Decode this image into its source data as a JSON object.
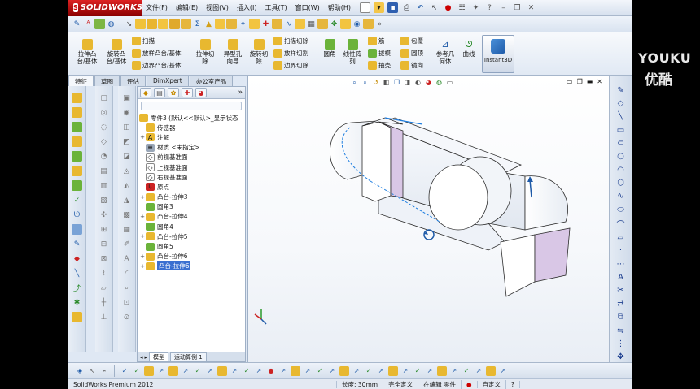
{
  "app": {
    "logo_text": "SOLIDWORKS",
    "menus": [
      "文件(F)",
      "编辑(E)",
      "视图(V)",
      "插入(I)",
      "工具(T)",
      "窗口(W)",
      "帮助(H)"
    ]
  },
  "command_manager": {
    "extrude_boss": "拉伸凸\n台/基体",
    "revolve_boss": "旋转凸\n台/基体",
    "sweep": "扫描",
    "loft_boss": "放样凸台/基体",
    "boundary_boss": "边界凸台/基体",
    "extrude_cut": "拉伸切\n除",
    "hole_wizard": "异型孔\n向导",
    "revolve_cut": "旋转切\n除",
    "swept_cut": "扫描切除",
    "lofted_cut": "放样切割",
    "boundary_cut": "边界切除",
    "fillet": "圆角",
    "linear_pattern": "线性阵\n列",
    "rib": "筋",
    "draft": "拔模",
    "shell": "抽壳",
    "wrap": "包覆",
    "dome": "圆顶",
    "mirror": "镜向",
    "reference_geometry": "参考几\n何体",
    "curves": "曲线",
    "instant3d": "Instant3D"
  },
  "cmd_tabs": [
    "特征",
    "草图",
    "评估",
    "DimXpert",
    "办公室产品"
  ],
  "feature_tree": {
    "root": "零件3  (默认<<默认>_显示状态",
    "items": [
      {
        "label": "传感器",
        "icon": "sensor-icon",
        "expand": ""
      },
      {
        "label": "注解",
        "icon": "annotation-icon",
        "expand": "+"
      },
      {
        "label": "材质 <未指定>",
        "icon": "material-icon",
        "expand": ""
      },
      {
        "label": "前视基准面",
        "icon": "plane-icon",
        "expand": ""
      },
      {
        "label": "上视基准面",
        "icon": "plane-icon",
        "expand": ""
      },
      {
        "label": "右视基准面",
        "icon": "plane-icon",
        "expand": ""
      },
      {
        "label": "原点",
        "icon": "origin-icon",
        "expand": ""
      },
      {
        "label": "凸台-拉伸3",
        "icon": "extrude-icon",
        "expand": "+"
      },
      {
        "label": "圆角3",
        "icon": "fillet-icon",
        "expand": ""
      },
      {
        "label": "凸台-拉伸4",
        "icon": "extrude-icon",
        "expand": "+"
      },
      {
        "label": "圆角4",
        "icon": "fillet-icon",
        "expand": ""
      },
      {
        "label": "凸台-拉伸5",
        "icon": "extrude-icon",
        "expand": "+"
      },
      {
        "label": "圆角5",
        "icon": "fillet-icon",
        "expand": ""
      },
      {
        "label": "凸台-拉伸6",
        "icon": "extrude-icon",
        "expand": "+"
      },
      {
        "label": "凸台-拉伸6",
        "icon": "extrude-icon",
        "expand": "+",
        "selected": true
      }
    ],
    "bottom_tabs": [
      "模型",
      "运动算例 1"
    ]
  },
  "status": {
    "product": "SolidWorks Premium 2012",
    "length": "长度: 30mm",
    "constraint": "完全定义",
    "editing": "在编辑 零件",
    "custom": "自定义"
  },
  "watermark": {
    "en": "YOUKU",
    "cn": "优酷"
  },
  "colors": {
    "accent": "#3a6fd0",
    "brand_red": "#c00000",
    "face_pink": "#d9c7e6",
    "edge": "#2b2b2b",
    "highlight_blue": "#1e7ee0"
  }
}
